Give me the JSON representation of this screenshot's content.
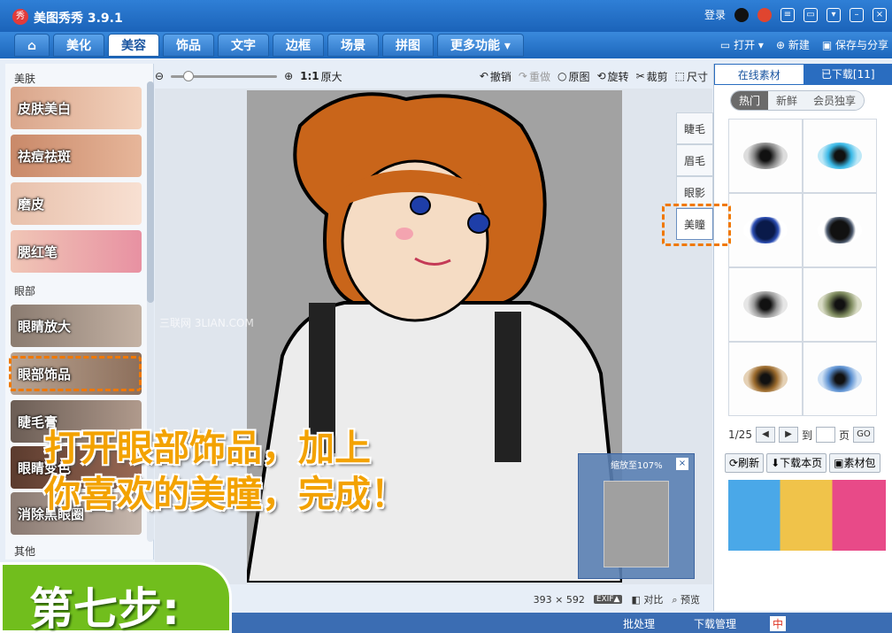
{
  "app": {
    "logo_text": "秀",
    "title": "美图秀秀 3.9.1"
  },
  "titlebar_right": {
    "login": "登录"
  },
  "nav": {
    "tabs": [
      "美化",
      "美容",
      "饰品",
      "文字",
      "边框",
      "场景",
      "拼图",
      "更多功能 ▾"
    ],
    "active_index": 1,
    "right": {
      "open": "打开",
      "new": "新建",
      "save": "保存与分享"
    }
  },
  "toolbar": {
    "ratio": "1:1",
    "original_size": "原大",
    "undo": "撤销",
    "redo": "重做",
    "original": "原图",
    "rotate": "旋转",
    "crop": "裁剪",
    "size": "尺寸"
  },
  "left_panel": {
    "section_skin": "美肤",
    "skin_items": [
      "皮肤美白",
      "祛痘祛斑",
      "磨皮",
      "腮红笔"
    ],
    "section_eye": "眼部",
    "eye_items": [
      "眼睛放大",
      "眼部饰品",
      "睫毛膏",
      "眼睛变色",
      "消除黑眼圈"
    ],
    "section_other": "其他"
  },
  "feature_tabs": [
    "睫毛",
    "眉毛",
    "眼影",
    "美瞳"
  ],
  "right_panel": {
    "tabs": [
      "在线素材",
      "已下载[11]"
    ],
    "filters": [
      "热门",
      "新鲜",
      "会员独享"
    ],
    "pager": {
      "current": "1/25",
      "goto": "到",
      "page": "页",
      "go": "GO"
    },
    "actions": [
      "刷新",
      "下载本页",
      "素材包"
    ]
  },
  "preview": {
    "label": "缩放至107%"
  },
  "status": {
    "width": "393",
    "times": "×",
    "height": "592",
    "exif": "EXIF▲",
    "compare": "对比",
    "preview": "预览"
  },
  "taskbar": {
    "batch": "批处理",
    "downloads": "下载管理",
    "ime": "中"
  },
  "overlay": {
    "line1": "打开眼部饰品，加上",
    "line2": "你喜欢的美瞳，完成！",
    "step": "第七步:"
  },
  "watermark": "三联网 3LIAN.COM"
}
